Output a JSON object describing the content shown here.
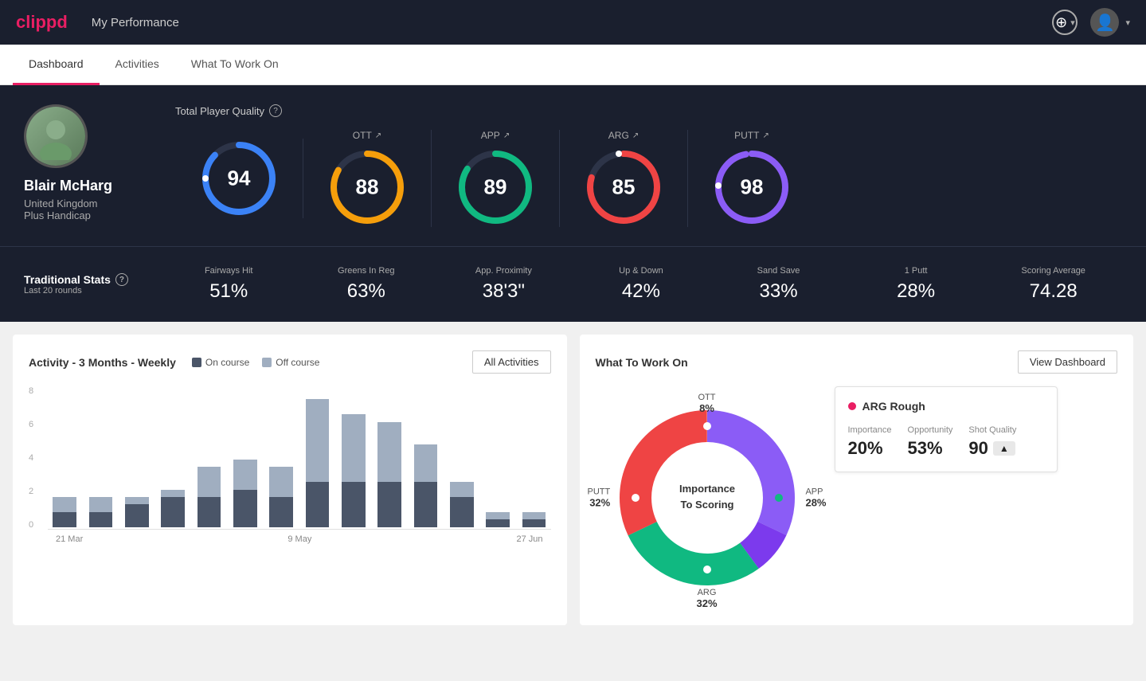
{
  "header": {
    "logo": "clippd",
    "title": "My Performance",
    "add_icon": "⊕",
    "chevron": "▾"
  },
  "tabs": [
    {
      "label": "Dashboard",
      "active": true
    },
    {
      "label": "Activities",
      "active": false
    },
    {
      "label": "What To Work On",
      "active": false
    }
  ],
  "player": {
    "name": "Blair McHarg",
    "country": "United Kingdom",
    "handicap": "Plus Handicap",
    "avatar_initial": "🧑"
  },
  "total_player_quality": {
    "label": "Total Player Quality",
    "value": 94,
    "color": "#3b82f6"
  },
  "metrics": [
    {
      "label": "OTT",
      "value": 88,
      "color": "#f59e0b",
      "trend": "↗"
    },
    {
      "label": "APP",
      "value": 89,
      "color": "#10b981",
      "trend": "↗"
    },
    {
      "label": "ARG",
      "value": 85,
      "color": "#ef4444",
      "trend": "↗"
    },
    {
      "label": "PUTT",
      "value": 98,
      "color": "#8b5cf6",
      "trend": "↗"
    }
  ],
  "traditional_stats": {
    "label": "Traditional Stats",
    "sublabel": "Last 20 rounds",
    "items": [
      {
        "label": "Fairways Hit",
        "value": "51%"
      },
      {
        "label": "Greens In Reg",
        "value": "63%"
      },
      {
        "label": "App. Proximity",
        "value": "38'3\""
      },
      {
        "label": "Up & Down",
        "value": "42%"
      },
      {
        "label": "Sand Save",
        "value": "33%"
      },
      {
        "label": "1 Putt",
        "value": "28%"
      },
      {
        "label": "Scoring Average",
        "value": "74.28"
      }
    ]
  },
  "activity_chart": {
    "title": "Activity - 3 Months - Weekly",
    "legend": [
      {
        "label": "On course",
        "color": "#4a5568"
      },
      {
        "label": "Off course",
        "color": "#a0aec0"
      }
    ],
    "all_activities_label": "All Activities",
    "x_labels": [
      "21 Mar",
      "9 May",
      "27 Jun"
    ],
    "y_labels": [
      "8",
      "6",
      "4",
      "2",
      "0"
    ],
    "bars": [
      {
        "on": 1,
        "off": 1
      },
      {
        "on": 1,
        "off": 1
      },
      {
        "on": 1.5,
        "off": 0.5
      },
      {
        "on": 2,
        "off": 0.5
      },
      {
        "on": 2,
        "off": 2
      },
      {
        "on": 2.5,
        "off": 2
      },
      {
        "on": 2,
        "off": 2
      },
      {
        "on": 3,
        "off": 5.5
      },
      {
        "on": 3,
        "off": 4.5
      },
      {
        "on": 3,
        "off": 4
      },
      {
        "on": 3,
        "off": 2.5
      },
      {
        "on": 2,
        "off": 1
      },
      {
        "on": 0.5,
        "off": 0.5
      },
      {
        "on": 0.5,
        "off": 0.5
      }
    ]
  },
  "what_to_work_on": {
    "title": "What To Work On",
    "view_dashboard_label": "View Dashboard",
    "donut_center": "Importance\nTo Scoring",
    "segments": [
      {
        "label": "OTT",
        "percent": "8%",
        "color": "#8b5cf6",
        "position": "top"
      },
      {
        "label": "APP",
        "percent": "28%",
        "color": "#10b981",
        "position": "right"
      },
      {
        "label": "ARG",
        "percent": "32%",
        "color": "#ef4444",
        "position": "bottom"
      },
      {
        "label": "PUTT",
        "percent": "32%",
        "color": "#8b5cf6",
        "position": "left"
      }
    ],
    "detail_card": {
      "title": "ARG Rough",
      "dot_color": "#e91e63",
      "metrics": [
        {
          "label": "Importance",
          "value": "20%"
        },
        {
          "label": "Opportunity",
          "value": "53%"
        },
        {
          "label": "Shot Quality",
          "value": "90"
        }
      ]
    }
  }
}
